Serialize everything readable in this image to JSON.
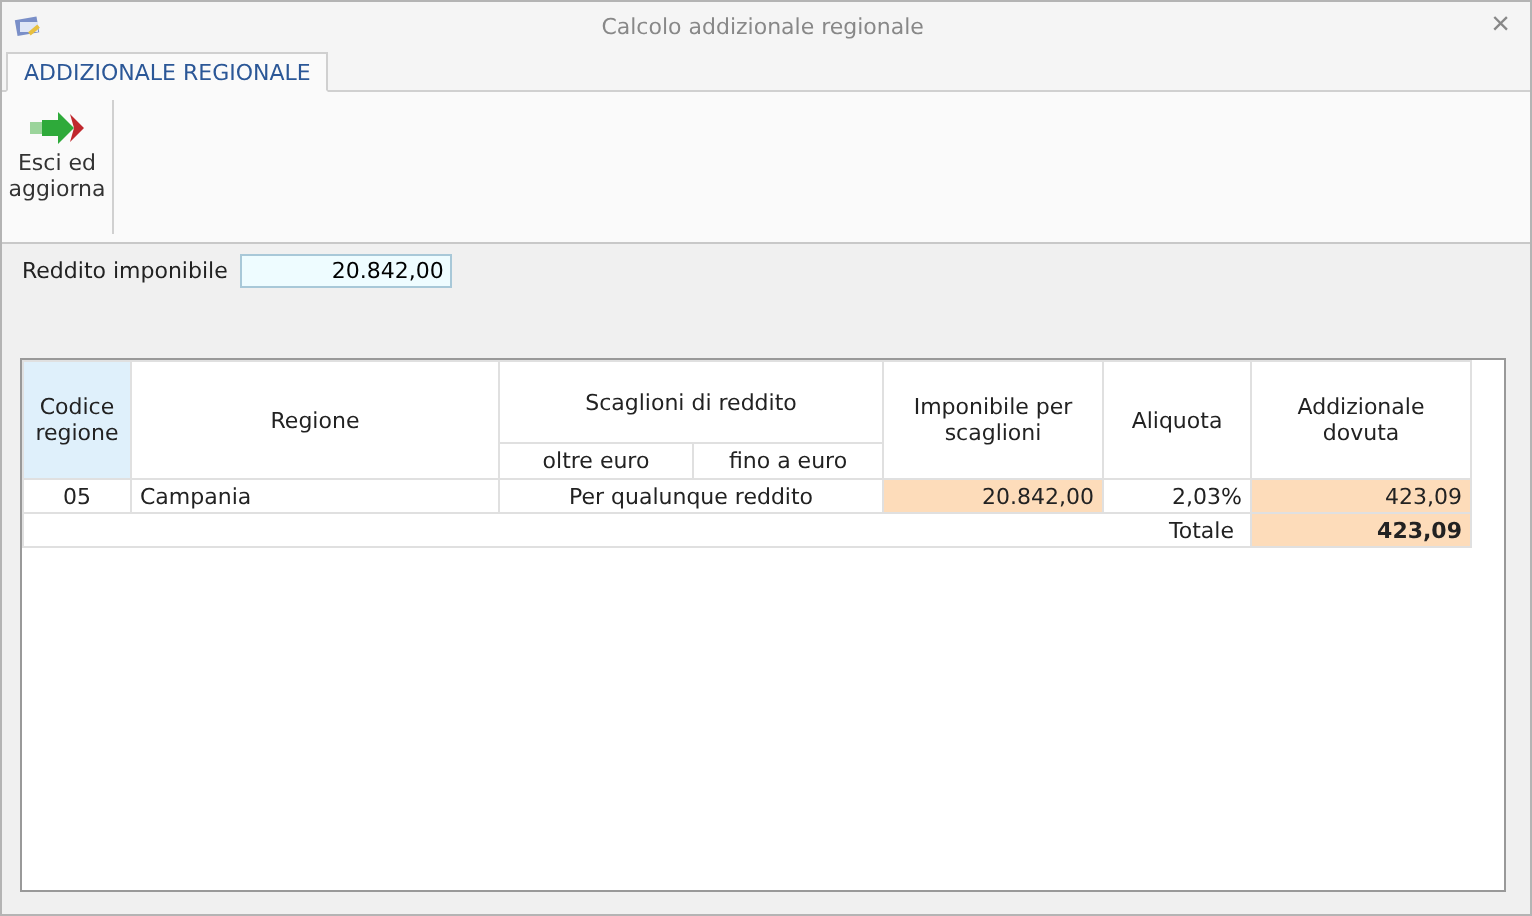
{
  "window": {
    "title": "Calcolo addizionale regionale",
    "close": "×"
  },
  "tabs": [
    {
      "label": "ADDIZIONALE REGIONALE",
      "selected": true
    }
  ],
  "toolbar": [
    {
      "label": "Esci ed aggiorna"
    }
  ],
  "income_field": {
    "label": "Reddito imponibile",
    "value": "20.842,00"
  },
  "table": {
    "columns": [
      {
        "label": "Codice regione",
        "selected": true,
        "kind": "plain"
      },
      {
        "label": "Regione",
        "selected": false,
        "kind": "plain"
      },
      {
        "label": "Scaglioni di reddito",
        "selected": false,
        "kind": "group",
        "children": [
          {
            "label": "oltre euro"
          },
          {
            "label": "fino a euro"
          }
        ]
      },
      {
        "label": "Imponibile per scaglioni",
        "selected": false,
        "kind": "computed"
      },
      {
        "label": "Aliquota",
        "selected": false,
        "kind": "plain"
      },
      {
        "label": "Addizionale dovuta",
        "selected": false,
        "kind": "computed"
      }
    ],
    "rows": [
      {
        "code": "05",
        "region": "Campania",
        "bracket": "Per qualunque reddito",
        "taxable": "20.842,00",
        "rate": "2,03%",
        "due": "423,09"
      }
    ],
    "total": {
      "label": "Totale",
      "value": "423,09"
    }
  }
}
